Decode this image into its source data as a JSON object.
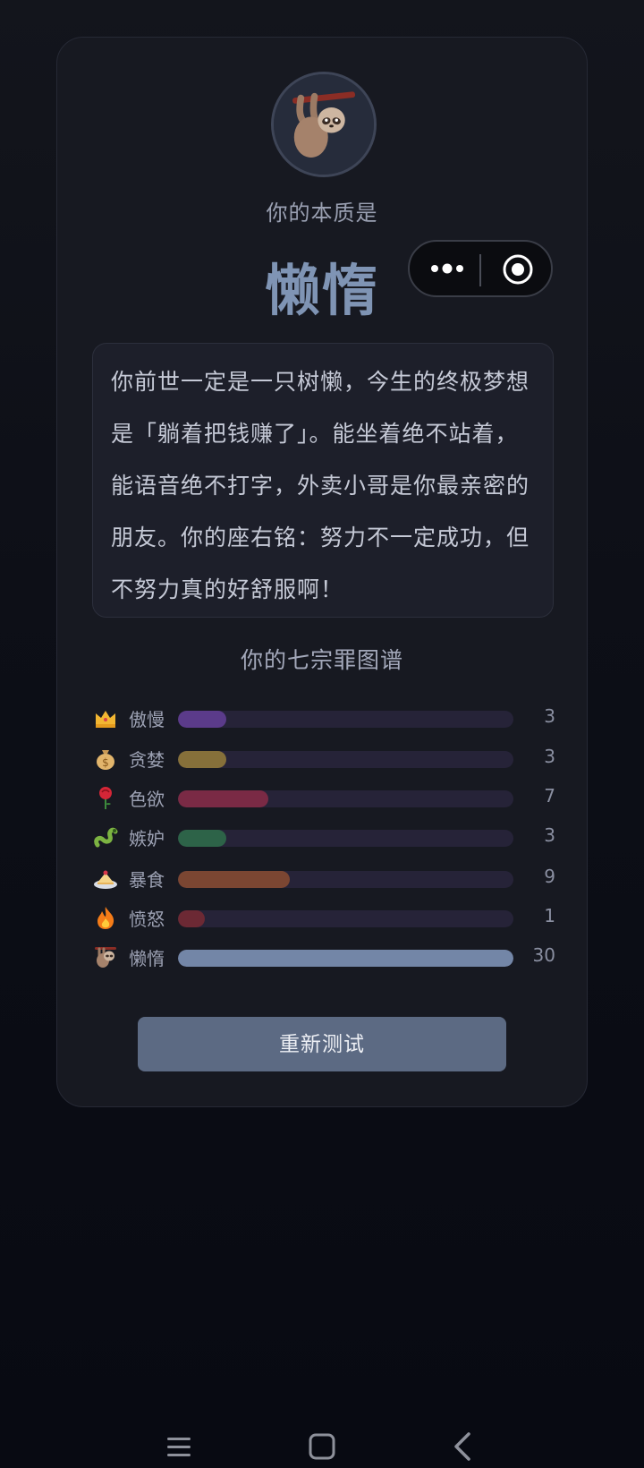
{
  "result": {
    "subtitle": "你的本质是",
    "title": "懒惰",
    "avatar_icon": "sloth-icon",
    "description": "你前世一定是一只树懒，今生的终极梦想是「躺着把钱赚了」。能坐着绝不站着，能语音绝不打字，外卖小哥是你最亲密的朋友。你的座右铭：努力不一定成功，但不努力真的好舒服啊！"
  },
  "capsule": {
    "more_icon": "more-dots-icon",
    "close_icon": "target-circle-icon"
  },
  "chart_data": {
    "type": "bar",
    "title": "你的七宗罪图谱",
    "orientation": "horizontal",
    "categories": [
      "傲慢",
      "贪婪",
      "色欲",
      "嫉妒",
      "暴食",
      "愤怒",
      "懒惰"
    ],
    "icons": [
      "crown-icon",
      "money-bag-icon",
      "rose-icon",
      "snake-icon",
      "cake-icon",
      "fire-icon",
      "sloth-icon"
    ],
    "values": [
      3,
      3,
      7,
      3,
      9,
      1,
      30
    ],
    "colors": [
      "#5b3b8a",
      "#86703a",
      "#7a2a45",
      "#2d6348",
      "#7b4632",
      "#6c2934",
      "#7386a7"
    ],
    "xlim": [
      0,
      30
    ],
    "grid": false
  },
  "actions": {
    "retry_label": "重新测试"
  },
  "system_nav": {
    "menu_icon": "menu-lines-icon",
    "home_icon": "home-square-icon",
    "back_icon": "back-chevron-icon"
  }
}
